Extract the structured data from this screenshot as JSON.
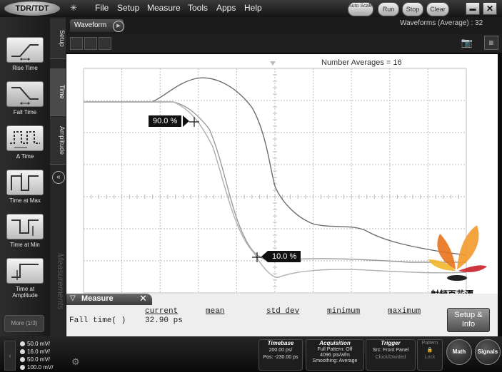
{
  "app": {
    "logo_text": "TDR/TDT"
  },
  "menu": {
    "items": [
      "File",
      "Setup",
      "Measure",
      "Tools",
      "Apps",
      "Help"
    ]
  },
  "topbuttons": {
    "autoscale": "Auto Scale",
    "run": "Run",
    "stop": "Stop",
    "clear": "Clear",
    "minimize": "▬",
    "close": "✕"
  },
  "sidebar": {
    "tools": [
      {
        "label": "Rise Time"
      },
      {
        "label": "Fall Time"
      },
      {
        "label": "Δ Time"
      },
      {
        "label": "Time at Max"
      },
      {
        "label": "Time at Min"
      },
      {
        "label": "Time at Amplitude"
      }
    ],
    "more": "More (1/3)",
    "tabs": {
      "setup": "Setup",
      "time": "Time",
      "amplitude": "Amplitude"
    },
    "collapse": "«",
    "measurements_label": "Measurements"
  },
  "wavepanel": {
    "tab": "Waveform",
    "count": "Waveforms (Average) : 32"
  },
  "plot": {
    "averages": "Number Averages = 16",
    "marker_90": "90.0 %",
    "marker_10": "10.0 %",
    "watermark": "射频百花潭"
  },
  "measure": {
    "title": "Measure",
    "columns": [
      "current",
      "mean",
      "std dev",
      "minimum",
      "maximum"
    ],
    "row_name": "Fall time(  )",
    "row_current": "32.90 ps",
    "setup_info": "Setup & Info"
  },
  "bottom": {
    "scales": [
      "50.0 mV/",
      "16.0 mV/",
      "50.0 mV/",
      "100.0 mV/"
    ],
    "timebase": {
      "title": "Timebase",
      "line1": "200.00 ps/",
      "line2": "Pos: -230.00 ps"
    },
    "acquisition": {
      "title": "Acquisition",
      "line1": "Full Pattern: Off",
      "line2": "4096 pts/wfm",
      "line3": "Smoothing: Average"
    },
    "trigger": {
      "title": "Trigger",
      "line1": "Src: Front Panel",
      "line2": "Clock/Divided"
    },
    "pattern": {
      "title": "Pattern",
      "line1": "Lock"
    },
    "math": "Math",
    "signals": "Signals"
  },
  "colors": {
    "trace1": "#6e6e6e",
    "trace2": "#9a9a9a",
    "trace3": "#b0b0b0",
    "grid": "#bdbdbd",
    "logo_orange": "#e8731c",
    "logo_red": "#c9202a"
  }
}
